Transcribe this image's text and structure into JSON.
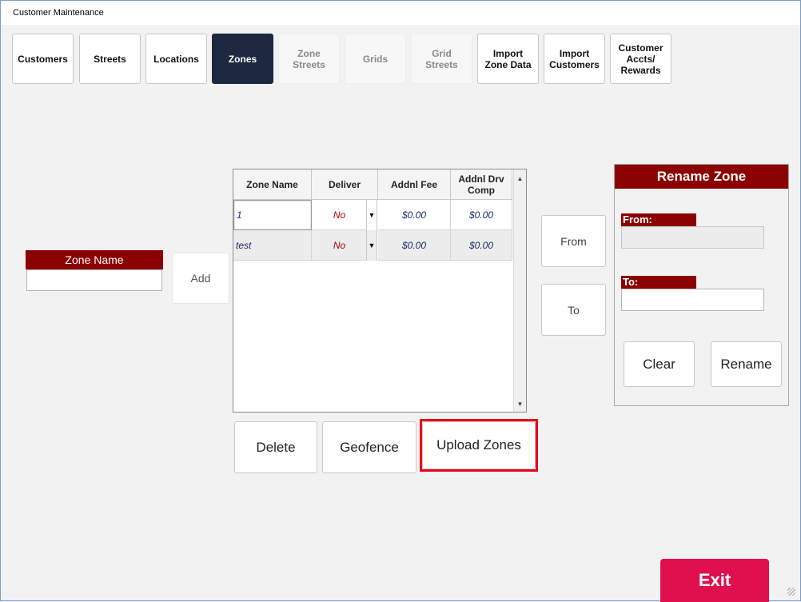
{
  "window": {
    "title": "Customer Maintenance"
  },
  "tabs": [
    {
      "label": "Customers",
      "state": "normal"
    },
    {
      "label": "Streets",
      "state": "normal"
    },
    {
      "label": "Locations",
      "state": "normal"
    },
    {
      "label": "Zones",
      "state": "active"
    },
    {
      "label": "Zone\nStreets",
      "state": "disabled"
    },
    {
      "label": "Grids",
      "state": "disabled"
    },
    {
      "label": "Grid\nStreets",
      "state": "disabled"
    },
    {
      "label": "Import\nZone Data",
      "state": "normal"
    },
    {
      "label": "Import\nCustomers",
      "state": "normal"
    },
    {
      "label": "Customer\nAccts/\nRewards",
      "state": "normal"
    }
  ],
  "add_zone": {
    "label": "Zone Name",
    "value": "",
    "add_button": "Add"
  },
  "grid": {
    "columns": [
      "Zone Name",
      "Deliver",
      "Addnl Fee",
      "Addnl Drv\nComp"
    ],
    "rows": [
      {
        "zone_name": "1",
        "deliver": "No",
        "addnl_fee": "$0.00",
        "addnl_drv_comp": "$0.00"
      },
      {
        "zone_name": "test",
        "deliver": "No",
        "addnl_fee": "$0.00",
        "addnl_drv_comp": "$0.00"
      }
    ]
  },
  "actions": {
    "delete": "Delete",
    "geofence": "Geofence",
    "upload_zones": "Upload Zones"
  },
  "from_to": {
    "from": "From",
    "to": "To"
  },
  "rename_zone": {
    "title": "Rename Zone",
    "from_label": "From:",
    "from_value": "",
    "to_label": "To:",
    "to_value": "",
    "clear": "Clear",
    "rename": "Rename"
  },
  "exit": "Exit",
  "colors": {
    "accent_red": "#8b0000",
    "active_tab": "#1c2940",
    "exit": "#e0104f",
    "highlight": "#e8001a"
  }
}
